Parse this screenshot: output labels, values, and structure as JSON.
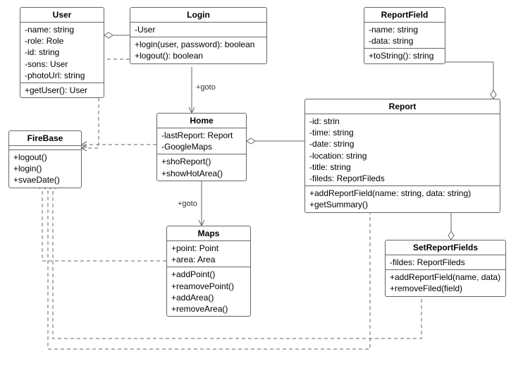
{
  "classes": {
    "user": {
      "name": "User",
      "attrs": [
        "-name: string",
        "-role: Role",
        "-id: string",
        "-sons: User",
        "-photoUrl: string"
      ],
      "ops": [
        "+getUser(): User"
      ]
    },
    "login": {
      "name": "Login",
      "attrs": [
        "-User"
      ],
      "ops": [
        "+login(user, password): boolean",
        "+logout(): boolean"
      ]
    },
    "reportfield": {
      "name": "ReportField",
      "attrs": [
        "-name: string",
        "-data: string"
      ],
      "ops": [
        "+toString(): string"
      ]
    },
    "firebase": {
      "name": "FireBase",
      "attrs": [],
      "ops": [
        "+logout()",
        "+login()",
        "+svaeDate()"
      ]
    },
    "home": {
      "name": "Home",
      "attrs": [
        "-lastReport: Report",
        "-GoogleMaps"
      ],
      "ops": [
        "+shoReport()",
        "+showHotArea()"
      ]
    },
    "report": {
      "name": "Report",
      "attrs": [
        "-id: strin",
        "-time: string",
        "-date: string",
        "-location: string",
        "-title: string",
        "-fileds: ReportFileds"
      ],
      "ops": [
        "+addReportField(name: string, data: string)",
        "+getSummary()"
      ]
    },
    "maps": {
      "name": "Maps",
      "attrs": [
        "+point: Point",
        "+area: Area"
      ],
      "ops": [
        "+addPoint()",
        "+reamovePoint()",
        "+addArea()",
        "+removeArea()"
      ]
    },
    "setreportfields": {
      "name": "SetReportFields",
      "attrs": [
        "-fildes: ReportFileds"
      ],
      "ops": [
        "+addReportField(name, data)",
        "+removeFiled(field)"
      ]
    }
  },
  "edgeLabels": {
    "loginToHome": "+goto",
    "homeToMaps": "+goto"
  }
}
